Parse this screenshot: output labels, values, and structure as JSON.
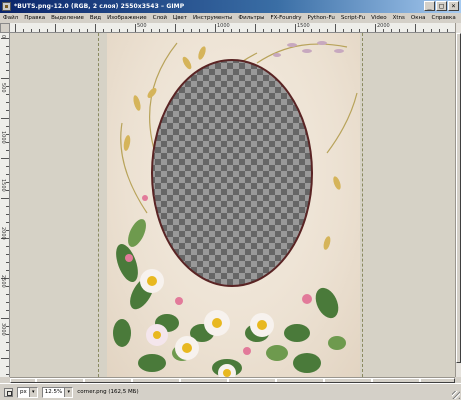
{
  "window": {
    "title": "*BUTS.png-12.0 (RGB, 2 слоя) 2550x3543 – GIMP",
    "minimize_glyph": "_",
    "maximize_glyph": "□",
    "close_glyph": "×"
  },
  "menu": {
    "items": [
      "Файл",
      "Правка",
      "Выделение",
      "Вид",
      "Изображение",
      "Слой",
      "Цвет",
      "Инструменты",
      "Фильтры",
      "FX-Foundry",
      "Python-Fu",
      "Script-Fu",
      "Video",
      "Xtns",
      "Окна",
      "Справка"
    ]
  },
  "ruler": {
    "h_labels": [
      "500",
      "1000",
      "1500",
      "2000",
      "2500"
    ],
    "v_labels": [
      "0",
      "500",
      "1000",
      "1500",
      "2000",
      "2500",
      "3000"
    ]
  },
  "status": {
    "unit": "px",
    "zoom": "12.5%",
    "text": "corner.png (162,5 МБ)"
  },
  "colors": {
    "frame_border": "#5a2424",
    "checker_dark": "#666666",
    "checker_light": "#999999"
  }
}
